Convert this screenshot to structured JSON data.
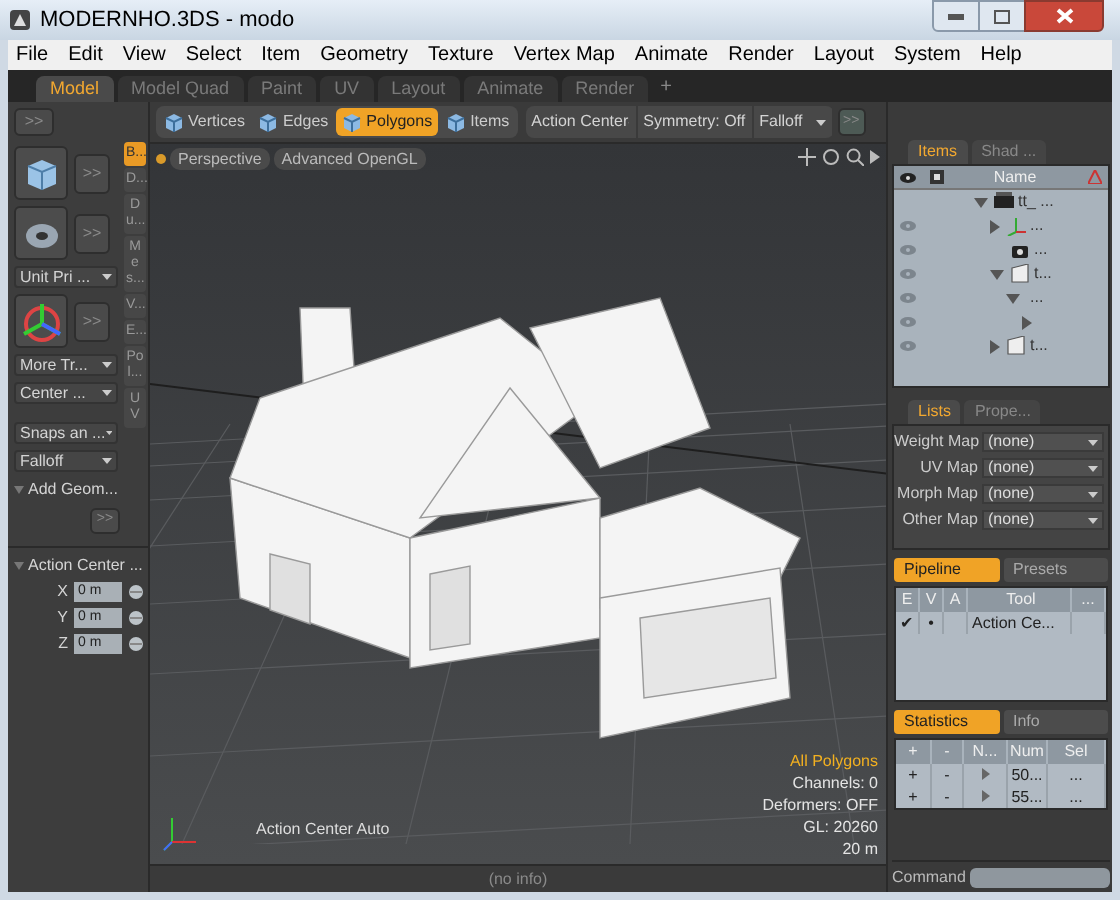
{
  "window": {
    "title": "MODERNHO.3DS - modo"
  },
  "menu": [
    "File",
    "Edit",
    "View",
    "Select",
    "Item",
    "Geometry",
    "Texture",
    "Vertex Map",
    "Animate",
    "Render",
    "Layout",
    "System",
    "Help"
  ],
  "layout_tabs": [
    {
      "label": "Model",
      "selected": true
    },
    {
      "label": "Model Quad",
      "selected": false
    },
    {
      "label": "Paint",
      "selected": false
    },
    {
      "label": "UV",
      "selected": false
    },
    {
      "label": "Layout",
      "selected": false
    },
    {
      "label": "Animate",
      "selected": false
    },
    {
      "label": "Render",
      "selected": false
    }
  ],
  "add_tab": "+",
  "toolbar": {
    "modes": [
      {
        "label": "Vertices",
        "selected": false
      },
      {
        "label": "Edges",
        "selected": false
      },
      {
        "label": "Polygons",
        "selected": true
      },
      {
        "label": "Items",
        "selected": false
      }
    ],
    "dropdowns": [
      "Action Center",
      "Symmetry: Off",
      "Falloff"
    ],
    "expand": ">>"
  },
  "left_panel": {
    "expand": ">>",
    "tool_expands": [
      ">>",
      ">>",
      ">>"
    ],
    "dropdowns": [
      "Unit Pri ...",
      "More Tr...",
      "Center ...",
      "Snaps an ...",
      "Falloff"
    ],
    "section": "Add Geom...",
    "more": ">>",
    "vertical_tabs": [
      {
        "label": "B...",
        "selected": true
      },
      {
        "label": "D...",
        "selected": false
      },
      {
        "label": "Du...",
        "selected": false
      },
      {
        "label": "Mes...",
        "selected": false
      },
      {
        "label": "V...",
        "selected": false
      },
      {
        "label": "E...",
        "selected": false
      },
      {
        "label": "Pol...",
        "selected": false
      },
      {
        "label": "UV",
        "selected": false
      }
    ],
    "action_center": {
      "title": "Action Center ...",
      "fields": [
        {
          "axis": "X",
          "value": "0 m"
        },
        {
          "axis": "Y",
          "value": "0 m"
        },
        {
          "axis": "Z",
          "value": "0 m"
        }
      ]
    }
  },
  "viewport": {
    "tabs": [
      "Perspective",
      "Advanced OpenGL"
    ],
    "overlay": "Action Center Auto",
    "info": [
      {
        "text": "All Polygons",
        "highlight": true
      },
      {
        "text": "Channels: 0",
        "highlight": false
      },
      {
        "text": "Deformers: OFF",
        "highlight": false
      },
      {
        "text": "GL: 20260",
        "highlight": false
      },
      {
        "text": "20 m",
        "highlight": false
      }
    ]
  },
  "status_bar": "(no info)",
  "items_panel": {
    "tabs": [
      {
        "label": "Items",
        "selected": true
      },
      {
        "label": "Shad ...",
        "selected": false
      }
    ],
    "name_column": "Name",
    "tree": [
      {
        "label": "tt_ ...",
        "kind": "scene",
        "visible": false,
        "expanded": true,
        "children": [
          {
            "label": "...",
            "kind": "locator",
            "visible": true,
            "expanded": false
          },
          {
            "label": "...",
            "kind": "camera",
            "visible": true
          },
          {
            "label": "t...",
            "kind": "mesh",
            "visible": true,
            "expanded": true,
            "children": [
              {
                "label": "...",
                "visible": true,
                "expanded": true,
                "children": [
                  {
                    "visible": true,
                    "expanded": false
                  }
                ]
              }
            ]
          },
          {
            "label": "t...",
            "kind": "mesh",
            "visible": true,
            "expanded": false
          }
        ]
      }
    ]
  },
  "lists_panel": {
    "tabs": [
      {
        "label": "Lists",
        "selected": true
      },
      {
        "label": "Prope...",
        "selected": false
      }
    ],
    "maps": [
      {
        "label": "Weight Map",
        "value": "(none)"
      },
      {
        "label": "UV Map",
        "value": "(none)"
      },
      {
        "label": "Morph Map",
        "value": "(none)"
      },
      {
        "label": "Other Map",
        "value": "(none)"
      }
    ]
  },
  "pipeline": {
    "tabs": [
      {
        "label": "Pipeline",
        "selected": true
      },
      {
        "label": "Presets",
        "selected": false
      }
    ],
    "columns": [
      "E",
      "V",
      "A",
      "Tool",
      "..."
    ],
    "rows": [
      [
        "✔",
        "•",
        "",
        "Action Ce...",
        ""
      ]
    ]
  },
  "statistics": {
    "tabs": [
      {
        "label": "Statistics",
        "selected": true
      },
      {
        "label": "Info",
        "selected": false
      }
    ],
    "columns": [
      "+",
      "-",
      "N...",
      "Num",
      "Sel"
    ],
    "rows": [
      [
        "+",
        "-",
        "",
        "50...",
        "..."
      ],
      [
        "+",
        "-",
        "",
        "55...",
        "..."
      ]
    ]
  },
  "command": {
    "label": "Command"
  }
}
